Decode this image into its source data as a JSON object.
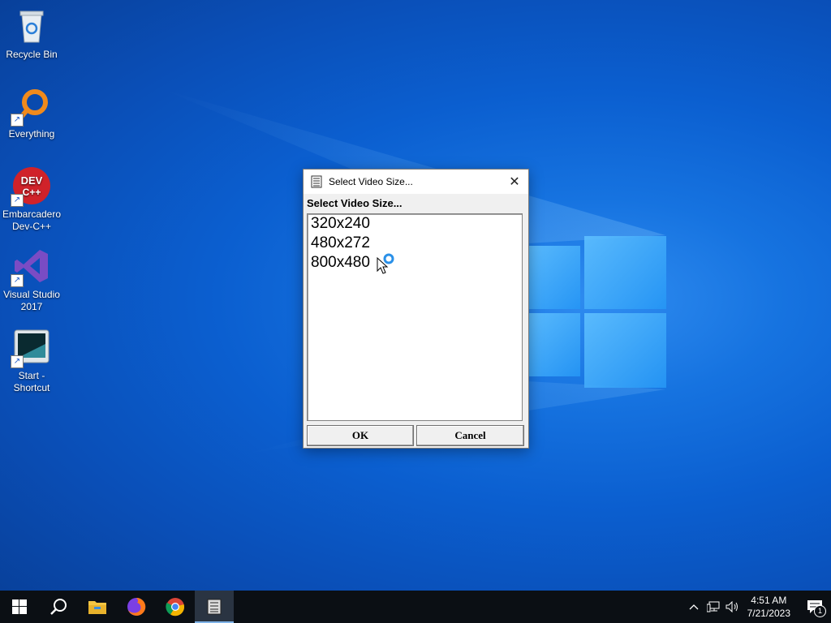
{
  "desktop": {
    "icons": [
      {
        "label": "Recycle Bin",
        "icon": "recycle-bin-icon"
      },
      {
        "label": "Everything",
        "icon": "everything-search-icon"
      },
      {
        "label": "Embarcadero Dev-C++",
        "icon": "devcpp-icon",
        "badge": "DEV C++"
      },
      {
        "label": "Visual Studio 2017",
        "icon": "visual-studio-icon"
      },
      {
        "label": "Start - Shortcut",
        "icon": "start-shortcut-icon"
      }
    ]
  },
  "dialog": {
    "title": "Select Video Size...",
    "prompt": "Select Video Size...",
    "options": [
      "320x240",
      "480x272",
      "800x480"
    ],
    "ok_label": "OK",
    "cancel_label": "Cancel"
  },
  "taskbar": {
    "apps": [
      "start-icon",
      "search-icon",
      "file-explorer-icon",
      "firefox-icon",
      "chrome-icon",
      "dialog-app-icon"
    ],
    "clock_time": "4:51 AM",
    "clock_date": "7/21/2023",
    "notification_count": "1"
  },
  "colors": {
    "desktop_blue": "#0b5fd0",
    "taskbar": "#0b0f14",
    "dialog_bg": "#f0f0f0"
  }
}
